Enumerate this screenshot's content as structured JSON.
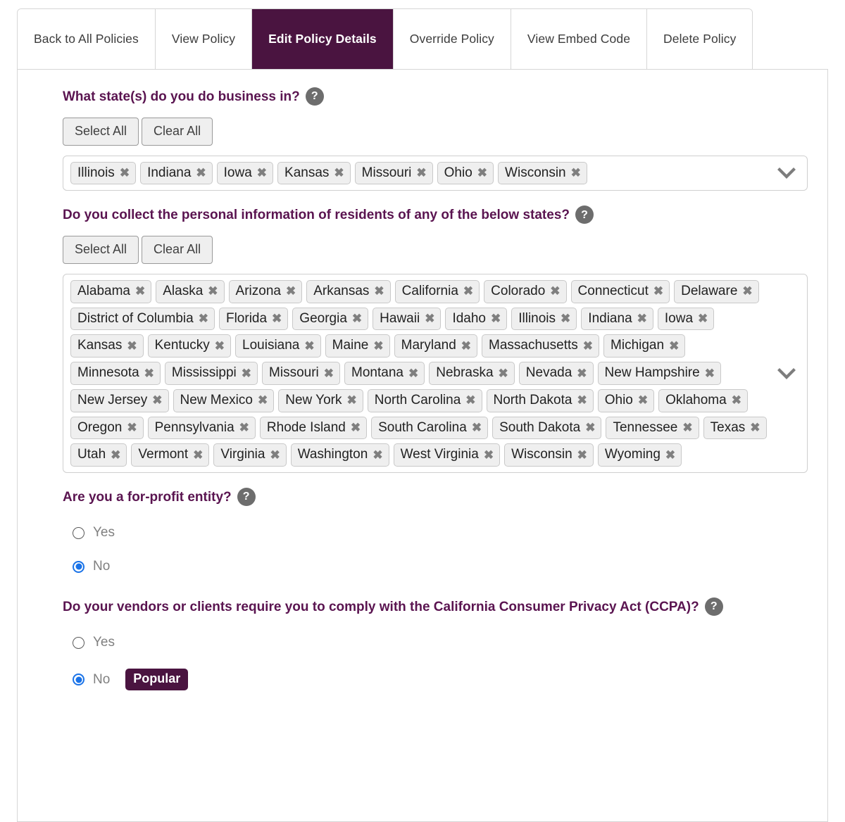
{
  "tabs": [
    {
      "label": "Back to All Policies",
      "active": false
    },
    {
      "label": "View Policy",
      "active": false
    },
    {
      "label": "Edit Policy Details",
      "active": true
    },
    {
      "label": "Override Policy",
      "active": false
    },
    {
      "label": "View Embed Code",
      "active": false
    },
    {
      "label": "Delete Policy",
      "active": false
    }
  ],
  "colors": {
    "brand_purple": "#4a1440",
    "question_purple": "#5a1450",
    "radio_blue": "#1a73e8",
    "help_gray": "#6d6d6d",
    "tag_bg": "#efefef",
    "border_gray": "#d6d6d6"
  },
  "buttons": {
    "select_all": "Select All",
    "clear_all": "Clear All"
  },
  "icons": {
    "help": "?",
    "remove": "✖",
    "chevron_down": "chevron-down-icon"
  },
  "sections": {
    "business_states": {
      "question": "What state(s) do you do business in?",
      "help": "?",
      "selected": [
        "Illinois",
        "Indiana",
        "Iowa",
        "Kansas",
        "Missouri",
        "Ohio",
        "Wisconsin"
      ]
    },
    "resident_states": {
      "question": "Do you collect the personal information of residents of any of the below states?",
      "help": "?",
      "selected": [
        "Alabama",
        "Alaska",
        "Arizona",
        "Arkansas",
        "California",
        "Colorado",
        "Connecticut",
        "Delaware",
        "District of Columbia",
        "Florida",
        "Georgia",
        "Hawaii",
        "Idaho",
        "Illinois",
        "Indiana",
        "Iowa",
        "Kansas",
        "Kentucky",
        "Louisiana",
        "Maine",
        "Maryland",
        "Massachusetts",
        "Michigan",
        "Minnesota",
        "Mississippi",
        "Missouri",
        "Montana",
        "Nebraska",
        "Nevada",
        "New Hampshire",
        "New Jersey",
        "New Mexico",
        "New York",
        "North Carolina",
        "North Dakota",
        "Ohio",
        "Oklahoma",
        "Oregon",
        "Pennsylvania",
        "Rhode Island",
        "South Carolina",
        "South Dakota",
        "Tennessee",
        "Texas",
        "Utah",
        "Vermont",
        "Virginia",
        "Washington",
        "West Virginia",
        "Wisconsin",
        "Wyoming"
      ]
    },
    "for_profit": {
      "question": "Are you a for-profit entity?",
      "help": "?",
      "options": [
        {
          "label": "Yes",
          "selected": false,
          "badge": null
        },
        {
          "label": "No",
          "selected": true,
          "badge": null
        }
      ]
    },
    "ccpa": {
      "question": "Do your vendors or clients require you to comply with the California Consumer Privacy Act (CCPA)?",
      "help": "?",
      "options": [
        {
          "label": "Yes",
          "selected": false,
          "badge": null
        },
        {
          "label": "No",
          "selected": true,
          "badge": "Popular"
        }
      ]
    }
  }
}
